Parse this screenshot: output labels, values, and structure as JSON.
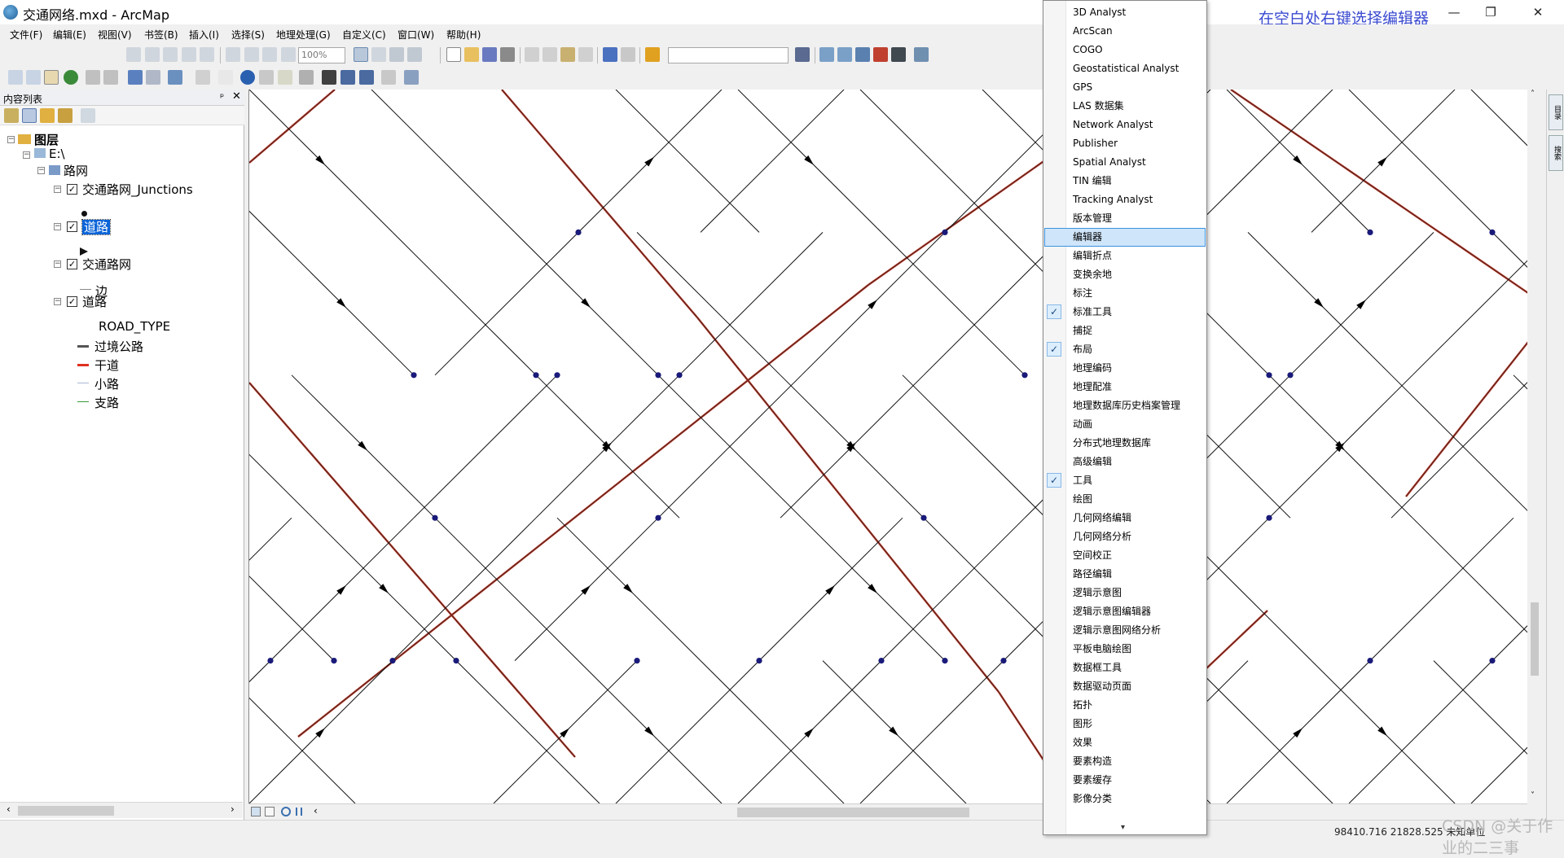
{
  "window": {
    "title": "交通网络.mxd - ArcMap",
    "hint": "在空白处右键选择编辑器",
    "minimize": "—",
    "restore": "❐",
    "close": "✕"
  },
  "menubar": [
    "文件(F)",
    "编辑(E)",
    "视图(V)",
    "书签(B)",
    "插入(I)",
    "选择(S)",
    "地理处理(G)",
    "自定义(C)",
    "窗口(W)",
    "帮助(H)"
  ],
  "toolbar": {
    "zoom_value": "100%",
    "scale_value": ""
  },
  "toc": {
    "title": "内容列表",
    "pin": "ᵖ",
    "close": "✕",
    "tree": {
      "root": "图层",
      "drive": "E:\\",
      "group": "路网",
      "junctions": "交通路网_Junctions",
      "roads_selected": "道路",
      "network": "交通路网",
      "edges": "边",
      "roads": "道路",
      "field": "ROAD_TYPE",
      "classes": [
        {
          "label": "过境公路",
          "color": "#555555"
        },
        {
          "label": "干道",
          "color": "#e03020"
        },
        {
          "label": "小路",
          "color": "#a8b8d0"
        },
        {
          "label": "支路",
          "color": "#3a9a3a"
        }
      ]
    }
  },
  "context_menu": {
    "items": [
      {
        "label": "3D Analyst",
        "checked": false
      },
      {
        "label": "ArcScan",
        "checked": false
      },
      {
        "label": "COGO",
        "checked": false
      },
      {
        "label": "Geostatistical Analyst",
        "checked": false
      },
      {
        "label": "GPS",
        "checked": false
      },
      {
        "label": "LAS 数据集",
        "checked": false
      },
      {
        "label": "Network Analyst",
        "checked": false
      },
      {
        "label": "Publisher",
        "checked": false
      },
      {
        "label": "Spatial Analyst",
        "checked": false
      },
      {
        "label": "TIN 编辑",
        "checked": false
      },
      {
        "label": "Tracking Analyst",
        "checked": false
      },
      {
        "label": "版本管理",
        "checked": false
      },
      {
        "label": "编辑器",
        "checked": false,
        "highlighted": true
      },
      {
        "label": "编辑折点",
        "checked": false
      },
      {
        "label": "变换余地",
        "checked": false
      },
      {
        "label": "标注",
        "checked": false
      },
      {
        "label": "标准工具",
        "checked": true
      },
      {
        "label": "捕捉",
        "checked": false
      },
      {
        "label": "布局",
        "checked": true
      },
      {
        "label": "地理编码",
        "checked": false
      },
      {
        "label": "地理配准",
        "checked": false
      },
      {
        "label": "地理数据库历史档案管理",
        "checked": false
      },
      {
        "label": "动画",
        "checked": false
      },
      {
        "label": "分布式地理数据库",
        "checked": false
      },
      {
        "label": "高级编辑",
        "checked": false
      },
      {
        "label": "工具",
        "checked": true
      },
      {
        "label": "绘图",
        "checked": false
      },
      {
        "label": "几何网络编辑",
        "checked": false
      },
      {
        "label": "几何网络分析",
        "checked": false
      },
      {
        "label": "空间校正",
        "checked": false
      },
      {
        "label": "路径编辑",
        "checked": false
      },
      {
        "label": "逻辑示意图",
        "checked": false
      },
      {
        "label": "逻辑示意图编辑器",
        "checked": false
      },
      {
        "label": "逻辑示意图网络分析",
        "checked": false
      },
      {
        "label": "平板电脑绘图",
        "checked": false
      },
      {
        "label": "数据框工具",
        "checked": false
      },
      {
        "label": "数据驱动页面",
        "checked": false
      },
      {
        "label": "拓扑",
        "checked": false
      },
      {
        "label": "图形",
        "checked": false
      },
      {
        "label": "效果",
        "checked": false
      },
      {
        "label": "要素构造",
        "checked": false
      },
      {
        "label": "要素缓存",
        "checked": false
      },
      {
        "label": "影像分类",
        "checked": false
      }
    ],
    "more": "▾",
    "check_glyph": "✓"
  },
  "right_dock": [
    "目录",
    "搜索"
  ],
  "status": {
    "coords": "98410.716  21828.525 未知单位",
    "watermark": "CSDN @关于作业的二三事"
  },
  "colors": {
    "trunk_road": "#b03020",
    "minor_road": "#111111",
    "junction": "#1a1a7a",
    "highlight": "#cfe5fa"
  }
}
